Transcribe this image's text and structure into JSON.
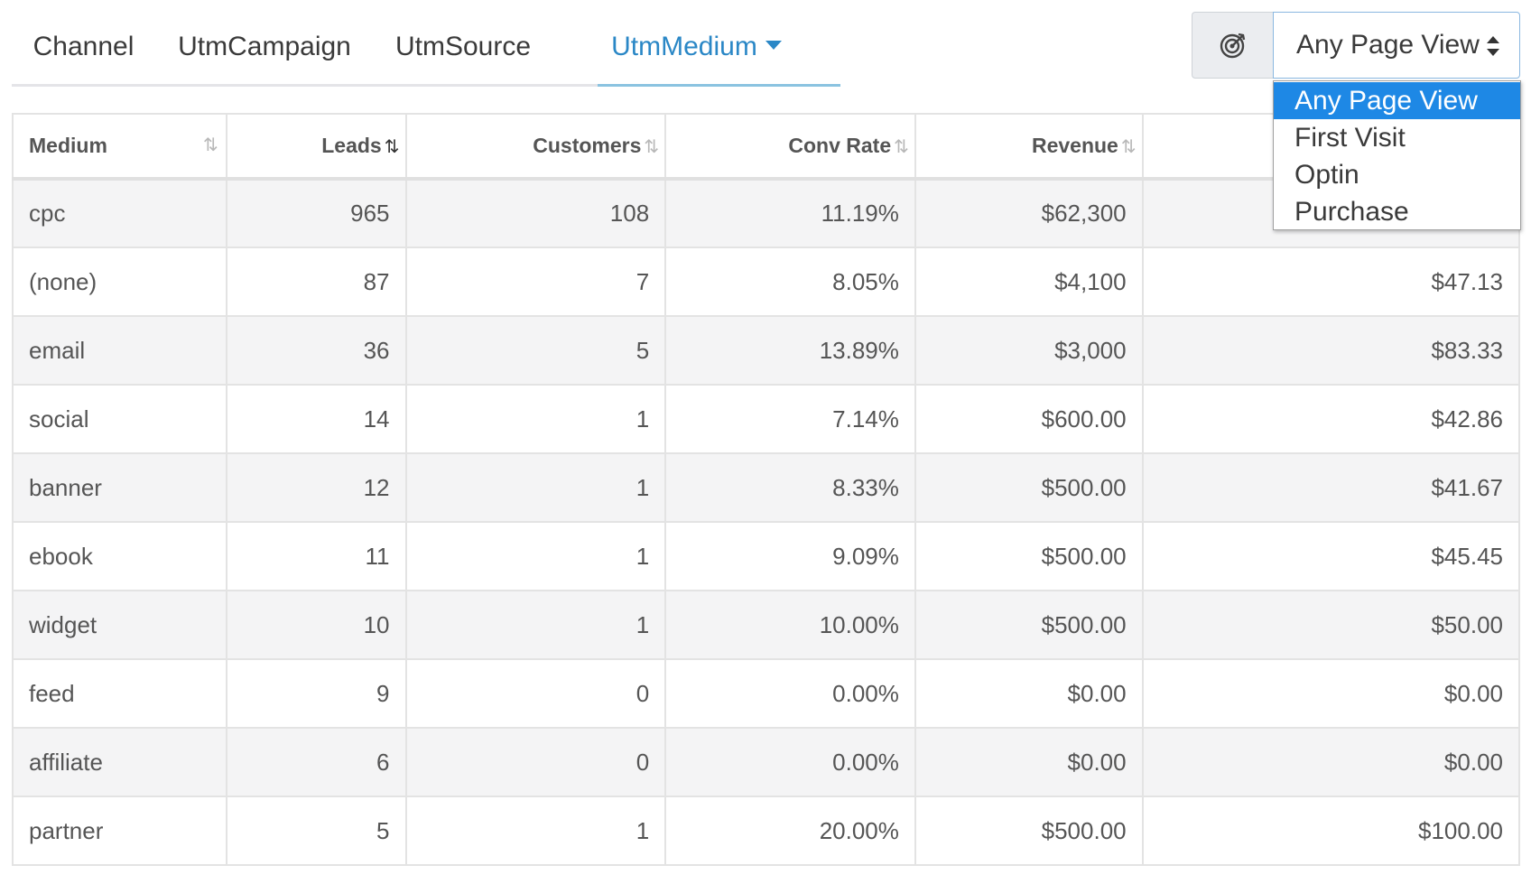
{
  "tabs": [
    {
      "label": "Channel"
    },
    {
      "label": "UtmCampaign"
    },
    {
      "label": "UtmSource"
    },
    {
      "label": "UtmMedium"
    }
  ],
  "active_tab": "UtmMedium",
  "goal_button": {
    "icon": "target-icon"
  },
  "goal_select": {
    "value": "Any Page View",
    "options": [
      "Any Page View",
      "First Visit",
      "Optin",
      "Purchase"
    ]
  },
  "table": {
    "columns": [
      "Medium",
      "Leads",
      "Customers",
      "Conv Rate",
      "Revenue",
      ""
    ],
    "sort_icon": "⇅",
    "sorted_column": "Leads",
    "rows": [
      {
        "medium": "cpc",
        "leads": "965",
        "customers": "108",
        "conv_rate": "11.19%",
        "revenue": "$62,300",
        "value": ""
      },
      {
        "medium": "(none)",
        "leads": "87",
        "customers": "7",
        "conv_rate": "8.05%",
        "revenue": "$4,100",
        "value": "$47.13"
      },
      {
        "medium": "email",
        "leads": "36",
        "customers": "5",
        "conv_rate": "13.89%",
        "revenue": "$3,000",
        "value": "$83.33"
      },
      {
        "medium": "social",
        "leads": "14",
        "customers": "1",
        "conv_rate": "7.14%",
        "revenue": "$600.00",
        "value": "$42.86"
      },
      {
        "medium": "banner",
        "leads": "12",
        "customers": "1",
        "conv_rate": "8.33%",
        "revenue": "$500.00",
        "value": "$41.67"
      },
      {
        "medium": "ebook",
        "leads": "11",
        "customers": "1",
        "conv_rate": "9.09%",
        "revenue": "$500.00",
        "value": "$45.45"
      },
      {
        "medium": "widget",
        "leads": "10",
        "customers": "1",
        "conv_rate": "10.00%",
        "revenue": "$500.00",
        "value": "$50.00"
      },
      {
        "medium": "feed",
        "leads": "9",
        "customers": "0",
        "conv_rate": "0.00%",
        "revenue": "$0.00",
        "value": "$0.00"
      },
      {
        "medium": "affiliate",
        "leads": "6",
        "customers": "0",
        "conv_rate": "0.00%",
        "revenue": "$0.00",
        "value": "$0.00"
      },
      {
        "medium": "partner",
        "leads": "5",
        "customers": "1",
        "conv_rate": "20.00%",
        "revenue": "$500.00",
        "value": "$100.00"
      }
    ]
  },
  "colors": {
    "accent": "#2a87c6",
    "selected_option": "#1e88e5"
  }
}
